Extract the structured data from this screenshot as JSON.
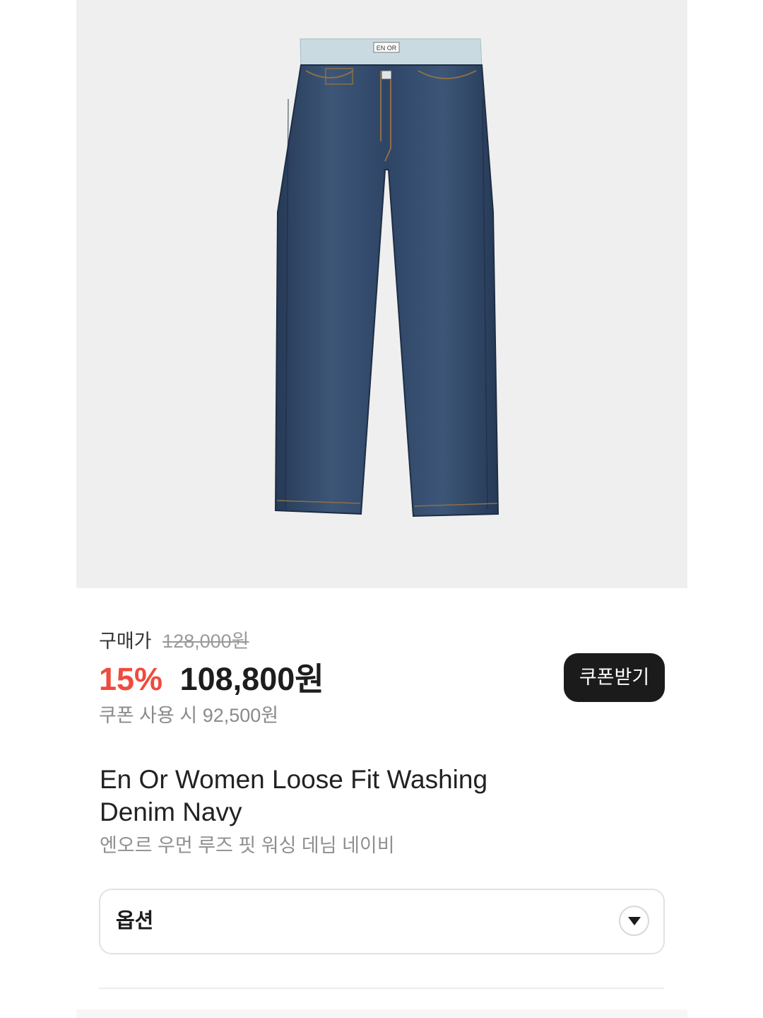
{
  "product_image": {
    "alt": "denim-jeans-icon",
    "waist_tag": "EN OR"
  },
  "price": {
    "label": "구매가",
    "original_price": "128,000원",
    "discount_rate": "15%",
    "sale_price": "108,800원",
    "coupon_info": "쿠폰 사용 시 92,500원"
  },
  "coupon_button": {
    "label": "쿠폰받기"
  },
  "product": {
    "name_en_line1": "En Or Women Loose Fit Washing",
    "name_en_line2": "Denim Navy",
    "name_ko": "엔오르 우먼 루즈 핏 워싱 데님 네이비"
  },
  "option": {
    "label": "옵션"
  },
  "colors": {
    "discount": "#ef4b3e",
    "button_bg": "#1b1b1b",
    "image_bg": "#efefef",
    "denim": "#2f4766"
  }
}
